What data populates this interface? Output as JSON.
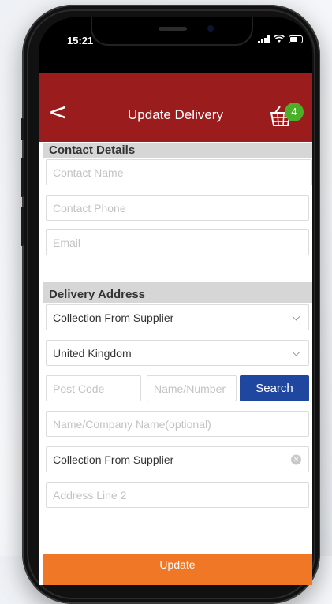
{
  "status_bar": {
    "time": "15:21"
  },
  "header": {
    "back_symbol": "<",
    "title": "Update Delivery",
    "basket_count": "4"
  },
  "contact": {
    "heading": "Contact Details",
    "name_placeholder": "Contact Name",
    "phone_placeholder": "Contact Phone",
    "email_placeholder": "Email"
  },
  "delivery": {
    "heading": "Delivery Address",
    "method_select": "Collection From Supplier",
    "country_select": "United Kingdom",
    "postcode_placeholder": "Post Code",
    "name_number_placeholder": "Name/Number",
    "search_label": "Search",
    "company_placeholder": "Name/Company Name(optional)",
    "address_line1_value": "Collection From Supplier",
    "address_line2_placeholder": "Address Line 2"
  },
  "update_label": "Update",
  "colors": {
    "header": "#9b1c1c",
    "badge": "#4caf2a",
    "search_button": "#1f47a0",
    "update_button": "#f07726"
  },
  "icons": [
    "back-arrow-icon",
    "basket-icon",
    "chevron-down-icon",
    "clear-icon",
    "signal-icon",
    "wifi-icon",
    "battery-icon"
  ]
}
